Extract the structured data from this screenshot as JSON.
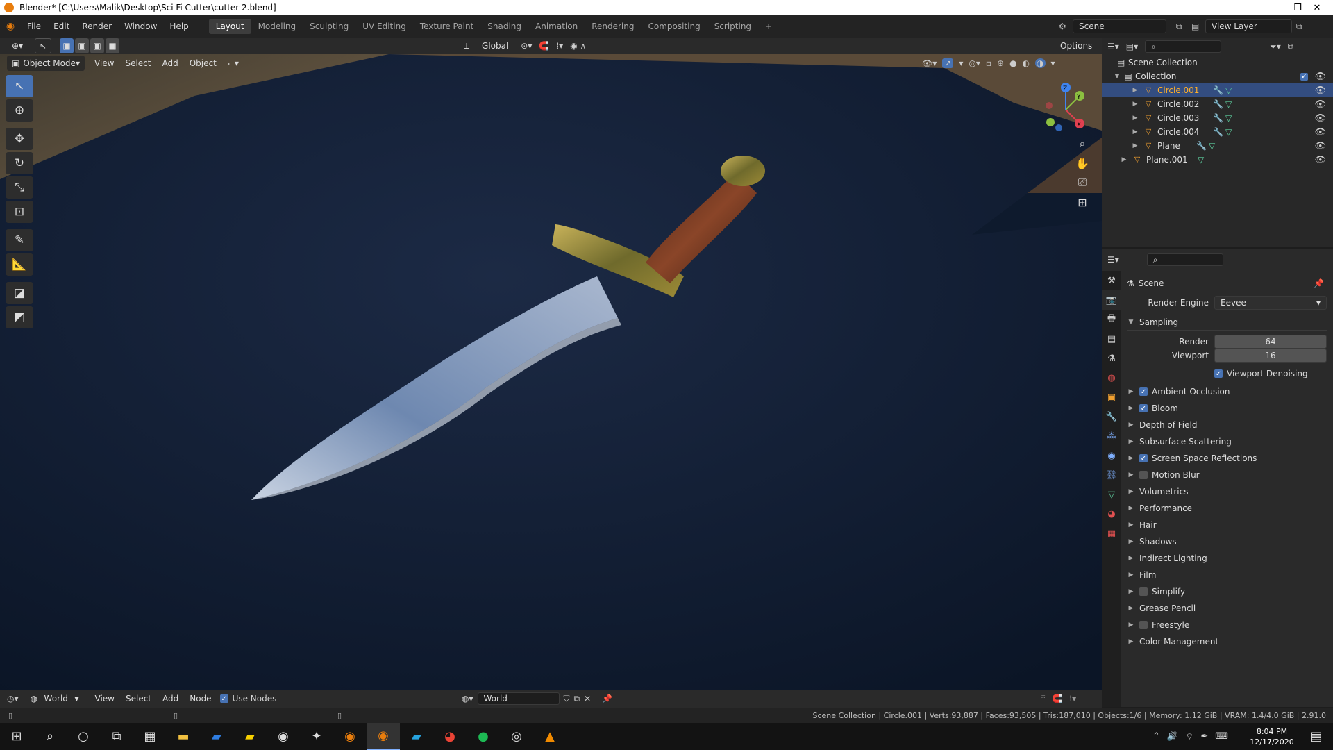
{
  "window": {
    "title": "Blender* [C:\\Users\\Malik\\Desktop\\Sci Fi Cutter\\cutter 2.blend]",
    "minimize": "—",
    "restore": "❐",
    "close": "✕"
  },
  "menu": [
    "File",
    "Edit",
    "Render",
    "Window",
    "Help"
  ],
  "workspaces": [
    "Layout",
    "Modeling",
    "Sculpting",
    "UV Editing",
    "Texture Paint",
    "Shading",
    "Animation",
    "Rendering",
    "Compositing",
    "Scripting",
    "+"
  ],
  "scene_field": "Scene",
  "view_layer_field": "View Layer",
  "viewport_header": {
    "transform_orientation": "Global",
    "options": "Options",
    "mode": "Object Mode",
    "view": "View",
    "select": "Select",
    "add": "Add",
    "object": "Object"
  },
  "outliner": {
    "root": "Scene Collection",
    "collection": "Collection",
    "items": [
      {
        "name": "Circle.001",
        "selected": true
      },
      {
        "name": "Circle.002",
        "selected": false
      },
      {
        "name": "Circle.003",
        "selected": false
      },
      {
        "name": "Circle.004",
        "selected": false
      },
      {
        "name": "Plane",
        "selected": false
      }
    ],
    "extra": "Plane.001"
  },
  "properties": {
    "title": "Scene",
    "render_engine_label": "Render Engine",
    "render_engine": "Eevee",
    "sampling_label": "Sampling",
    "render_label": "Render",
    "render_value": "64",
    "viewport_label": "Viewport",
    "viewport_value": "16",
    "viewport_denoising": "Viewport Denoising",
    "panels": [
      {
        "label": "Ambient Occlusion",
        "checkbox": true,
        "checked": true
      },
      {
        "label": "Bloom",
        "checkbox": true,
        "checked": true
      },
      {
        "label": "Depth of Field",
        "checkbox": false,
        "checked": false
      },
      {
        "label": "Subsurface Scattering",
        "checkbox": false,
        "checked": false
      },
      {
        "label": "Screen Space Reflections",
        "checkbox": true,
        "checked": true
      },
      {
        "label": "Motion Blur",
        "checkbox": true,
        "checked": false
      },
      {
        "label": "Volumetrics",
        "checkbox": false,
        "checked": false
      },
      {
        "label": "Performance",
        "checkbox": false,
        "checked": false
      },
      {
        "label": "Hair",
        "checkbox": false,
        "checked": false
      },
      {
        "label": "Shadows",
        "checkbox": false,
        "checked": false
      },
      {
        "label": "Indirect Lighting",
        "checkbox": false,
        "checked": false
      },
      {
        "label": "Film",
        "checkbox": false,
        "checked": false
      },
      {
        "label": "Simplify",
        "checkbox": true,
        "checked": false
      },
      {
        "label": "Grease Pencil",
        "checkbox": false,
        "checked": false
      },
      {
        "label": "Freestyle",
        "checkbox": true,
        "checked": false
      },
      {
        "label": "Color Management",
        "checkbox": false,
        "checked": false
      }
    ]
  },
  "node_header": {
    "world": "World",
    "view": "View",
    "select": "Select",
    "add": "Add",
    "node": "Node",
    "use_nodes": "Use Nodes",
    "world_field": "World"
  },
  "status": "Scene Collection | Circle.001 | Verts:93,887 | Faces:93,505 | Tris:187,010 | Objects:1/6 | Memory: 1.12 GiB | VRAM: 1.4/4.0 GiB | 2.91.0",
  "taskbar": {
    "time": "8:04 PM",
    "date": "12/17/2020"
  },
  "gizmo": {
    "x": "X",
    "y": "Y",
    "z": "Z"
  },
  "colors": {
    "accent": "#4772b3",
    "selected_row": "#334d80",
    "blender_orange": "#e87d0d"
  }
}
